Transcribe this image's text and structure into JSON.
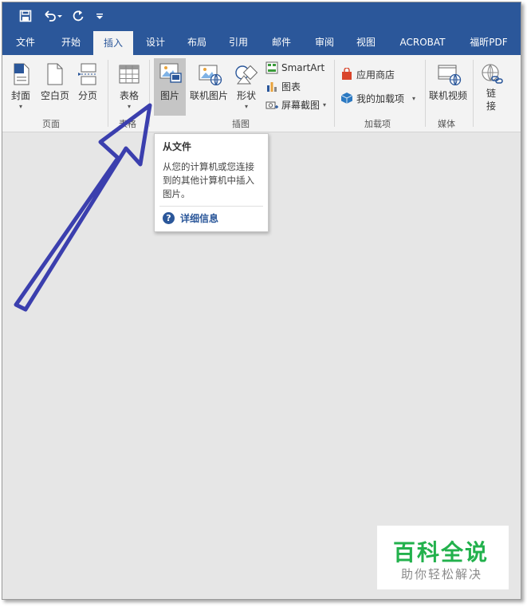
{
  "quick_access": {
    "save_icon": "save-icon",
    "undo_icon": "undo-icon",
    "redo_icon": "redo-icon",
    "customize_icon": "customize-icon"
  },
  "tabs": [
    {
      "label": "文件"
    },
    {
      "label": "开始"
    },
    {
      "label": "插入",
      "active": true
    },
    {
      "label": "设计"
    },
    {
      "label": "布局"
    },
    {
      "label": "引用"
    },
    {
      "label": "邮件"
    },
    {
      "label": "审阅"
    },
    {
      "label": "视图"
    },
    {
      "label": "ACROBAT"
    },
    {
      "label": "福昕PDF"
    }
  ],
  "ribbon": {
    "pages_group": {
      "label": "页面",
      "cover": "封面",
      "blank_page": "空白页",
      "page_break": "分页"
    },
    "table_group": {
      "label": "表格",
      "table": "表格"
    },
    "illustrations_group": {
      "label": "插图",
      "pictures": "图片",
      "online_pictures": "联机图片",
      "shapes": "形状",
      "smartart": "SmartArt",
      "chart": "图表",
      "screenshot": "屏幕截图"
    },
    "addins_group": {
      "label": "加载项",
      "store": "应用商店",
      "my_addins": "我的加载项"
    },
    "media_group": {
      "label": "媒体",
      "online_video": "联机视频"
    },
    "links_group": {
      "link": "链接"
    }
  },
  "tooltip": {
    "title": "从文件",
    "body": "从您的计算机或您连接到的其他计算机中插入图片。",
    "help": "详细信息"
  },
  "watermark": {
    "main": "百科全说",
    "sub": "助你轻松解决"
  },
  "colors": {
    "accent": "#2b579a",
    "arrow": "#3b3fae",
    "watermark_green": "#22b14c"
  }
}
